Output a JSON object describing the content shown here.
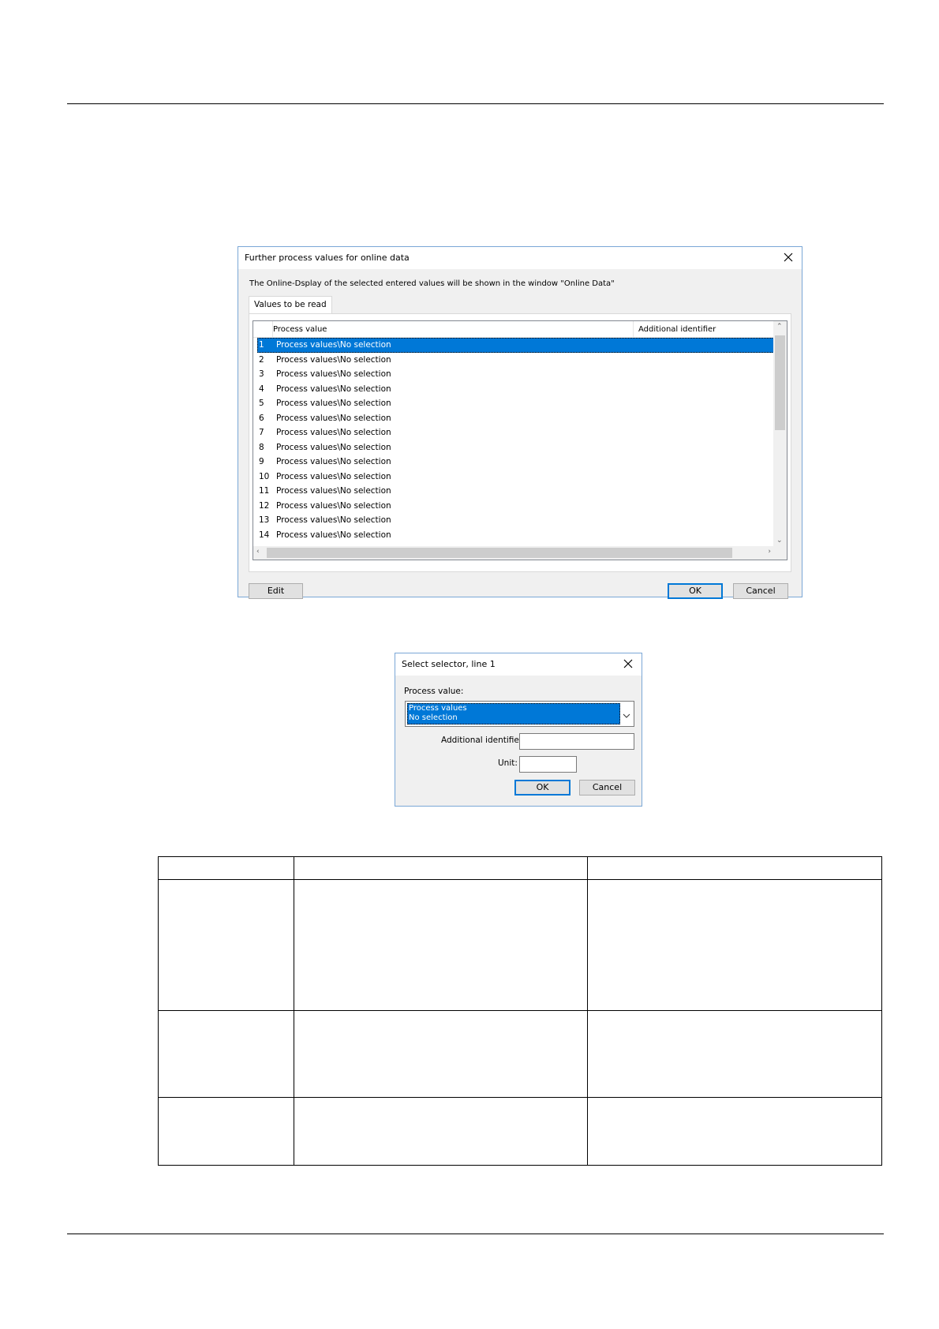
{
  "dialog1": {
    "title": "Further process values for online data",
    "description": "The Online-Dsplay of the selected entered values will be shown in the window \"Online Data\"",
    "tab": "Values to be read",
    "columns": [
      "Process value",
      "Additional identifier"
    ],
    "rows": [
      {
        "num": "1",
        "value": "Process values\\No selection",
        "selected": true
      },
      {
        "num": "2",
        "value": "Process values\\No selection"
      },
      {
        "num": "3",
        "value": "Process values\\No selection"
      },
      {
        "num": "4",
        "value": "Process values\\No selection"
      },
      {
        "num": "5",
        "value": "Process values\\No selection"
      },
      {
        "num": "6",
        "value": "Process values\\No selection"
      },
      {
        "num": "7",
        "value": "Process values\\No selection"
      },
      {
        "num": "8",
        "value": "Process values\\No selection"
      },
      {
        "num": "9",
        "value": "Process values\\No selection"
      },
      {
        "num": "10",
        "value": "Process values\\No selection"
      },
      {
        "num": "11",
        "value": "Process values\\No selection"
      },
      {
        "num": "12",
        "value": "Process values\\No selection"
      },
      {
        "num": "13",
        "value": "Process values\\No selection"
      },
      {
        "num": "14",
        "value": "Process values\\No selection"
      }
    ],
    "buttons": {
      "edit": "Edit",
      "ok": "OK",
      "cancel": "Cancel"
    }
  },
  "dialog2": {
    "title": "Select selector, line 1",
    "process_value_label": "Process value:",
    "combo_line1": "Process values",
    "combo_line2": "No selection",
    "additional_identifier_label": "Additional identifier:",
    "unit_label": "Unit:",
    "additional_identifier_value": "",
    "unit_value": "",
    "buttons": {
      "ok": "OK",
      "cancel": "Cancel"
    }
  },
  "colors": {
    "selection": "#0078d7",
    "dialog_bg": "#f0f0f0",
    "dialog_border": "#7aa7d6"
  },
  "icons": [
    "close-icon",
    "chevron-down-icon",
    "scroll-up-icon",
    "scroll-down-icon",
    "scroll-left-icon",
    "scroll-right-icon"
  ]
}
